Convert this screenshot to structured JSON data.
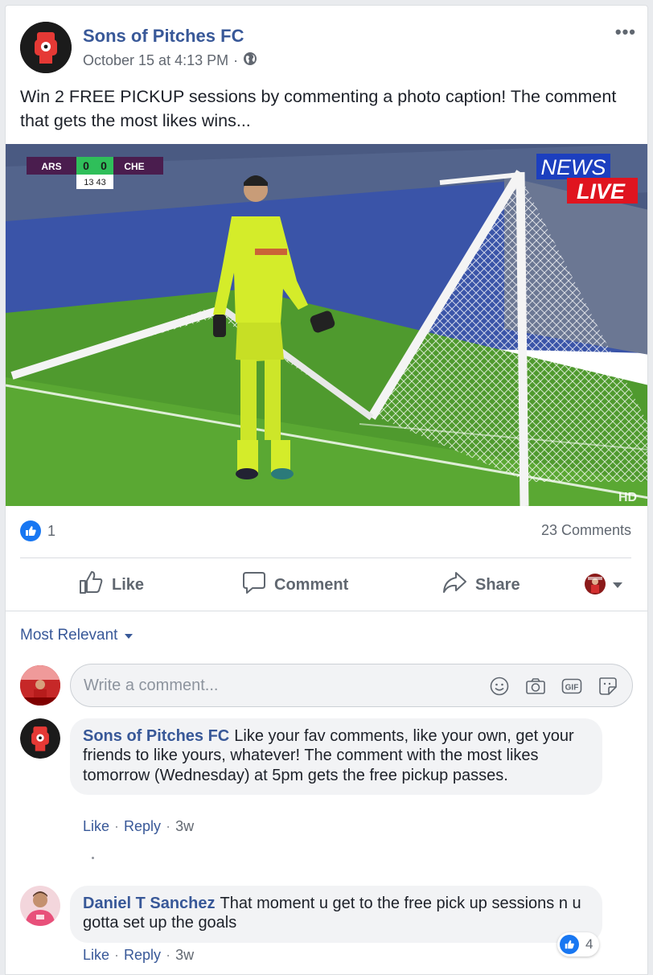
{
  "post": {
    "page_name": "Sons of Pitches FC",
    "timestamp": "October 15 at 4:13 PM",
    "separator": "·",
    "audience_icon": "globe-icon",
    "more_label": "•••",
    "text": "Win 2 FREE PICKUP sessions by commenting a photo caption! The comment that gets the most likes wins..."
  },
  "photo": {
    "scoreboard": {
      "home": "ARS",
      "home_score": "0",
      "away_score": "0",
      "away": "CHE",
      "clock": "13 43"
    },
    "badge_top": "NEWS",
    "badge_bottom": "LIVE",
    "corner_mark": "HD"
  },
  "reactions": {
    "like_count": "1",
    "comments_label": "23 Comments"
  },
  "actions": {
    "like": "Like",
    "comment": "Comment",
    "share": "Share"
  },
  "sort": {
    "label": "Most Relevant"
  },
  "composer": {
    "placeholder": "Write a comment...",
    "gif_label": "GIF"
  },
  "comments": [
    {
      "author": "Sons of Pitches FC",
      "text": "Like your fav comments, like your own, get your friends to like yours, whatever! The comment with the most likes tomorrow (Wednesday) at 5pm gets the free pickup passes.",
      "like": "Like",
      "reply": "Reply",
      "time": "3w"
    },
    {
      "author": "Daniel T Sanchez",
      "text": "That moment u get to the free pick up sessions n u gotta set up the goals",
      "like": "Like",
      "reply": "Reply",
      "time": "3w",
      "like_count": "4"
    }
  ],
  "colors": {
    "link": "#385898",
    "like_blue": "#1877f2",
    "pitch": "#4f9a2e",
    "keeper_kit": "#d4ec2a"
  }
}
